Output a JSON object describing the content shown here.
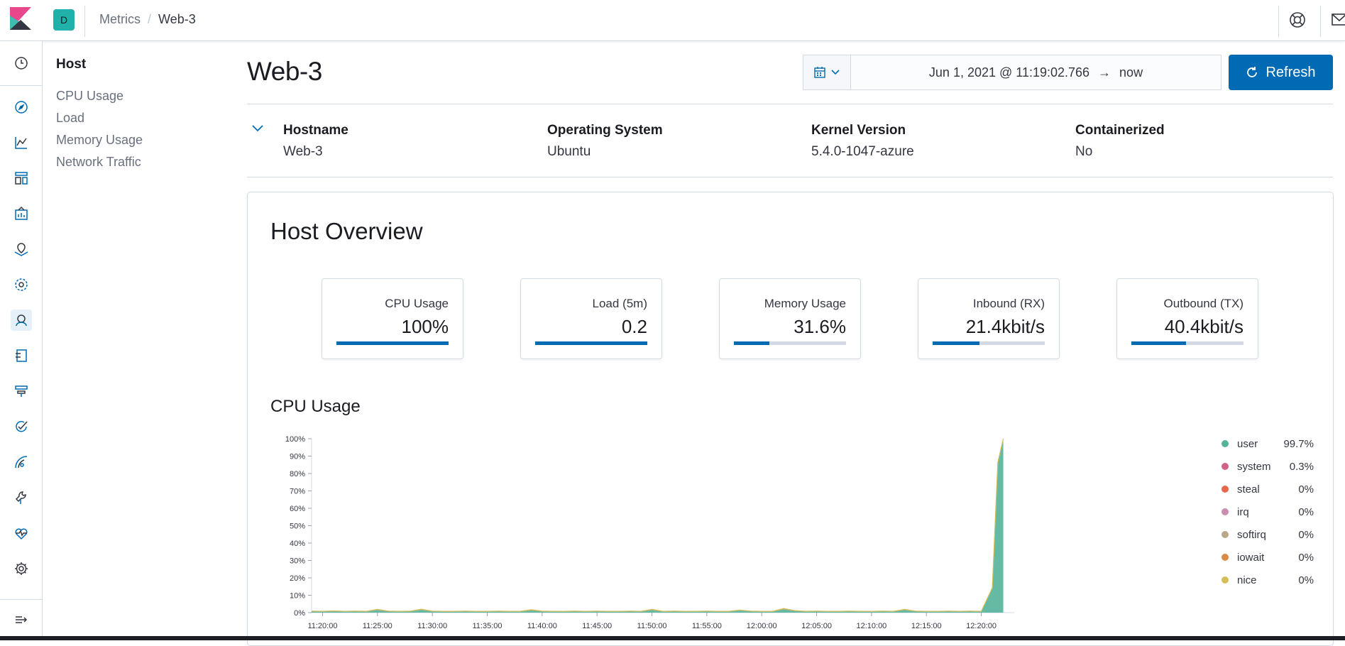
{
  "header": {
    "space_initial": "D",
    "breadcrumb_parent": "Metrics",
    "breadcrumb_sep": "/",
    "breadcrumb_current": "Web-3"
  },
  "sidenav": {
    "title": "Host",
    "items": [
      "CPU Usage",
      "Load",
      "Memory Usage",
      "Network Traffic"
    ]
  },
  "page": {
    "title": "Web-3"
  },
  "datepicker": {
    "start": "Jun 1, 2021 @ 11:19:02.766",
    "arrow": "→",
    "end": "now"
  },
  "refresh_label": "Refresh",
  "host_info": [
    {
      "label": "Hostname",
      "value": "Web-3"
    },
    {
      "label": "Operating System",
      "value": "Ubuntu"
    },
    {
      "label": "Kernel Version",
      "value": "5.4.0-1047-azure"
    },
    {
      "label": "Containerized",
      "value": "No"
    }
  ],
  "overview": {
    "title": "Host Overview",
    "kpis": [
      {
        "label": "CPU Usage",
        "value": "100%",
        "fraction": 1.0
      },
      {
        "label": "Load (5m)",
        "value": "0.2",
        "fraction": 1.0
      },
      {
        "label": "Memory Usage",
        "value": "31.6%",
        "fraction": 0.316
      },
      {
        "label": "Inbound (RX)",
        "value": "21.4kbit/s",
        "fraction": 0.42
      },
      {
        "label": "Outbound (TX)",
        "value": "40.4kbit/s",
        "fraction": 0.49
      }
    ]
  },
  "colors": {
    "accent": "#006bb4",
    "user": "#54b399",
    "system": "#d36086",
    "steal": "#e7664c",
    "irq": "#ca8eae",
    "softirq": "#b9a888",
    "iowait": "#da8b45",
    "nice": "#d6bf57"
  },
  "chart_data": {
    "type": "area",
    "title": "CPU Usage",
    "y_ticks": [
      "0%",
      "10%",
      "20%",
      "30%",
      "40%",
      "50%",
      "60%",
      "70%",
      "80%",
      "90%",
      "100%"
    ],
    "x_ticks": [
      "11:20:00",
      "11:25:00",
      "11:30:00",
      "11:35:00",
      "11:40:00",
      "11:45:00",
      "11:50:00",
      "11:55:00",
      "12:00:00",
      "12:05:00",
      "12:10:00",
      "12:15:00",
      "12:20:00"
    ],
    "ylim": [
      0,
      100
    ],
    "x_minutes": [
      0,
      1,
      2,
      3,
      4,
      5,
      6,
      7,
      8,
      9,
      10,
      11,
      12,
      13,
      14,
      15,
      16,
      17,
      18,
      19,
      20,
      21,
      22,
      23,
      24,
      25,
      26,
      27,
      28,
      29,
      30,
      31,
      32,
      33,
      34,
      35,
      36,
      37,
      38,
      39,
      40,
      41,
      42,
      43,
      44,
      45,
      46,
      47,
      48,
      49,
      50,
      51,
      52,
      53,
      54,
      55,
      56,
      57,
      58,
      59,
      60,
      61,
      62,
      62.5,
      63
    ],
    "series": [
      {
        "name": "user",
        "values": [
          0.6,
          0.5,
          0.7,
          0.5,
          0.6,
          0.5,
          1.5,
          0.6,
          0.5,
          0.6,
          1.6,
          0.6,
          0.5,
          0.5,
          0.6,
          0.5,
          0.5,
          0.6,
          0.5,
          0.5,
          1.3,
          0.6,
          0.5,
          0.5,
          0.6,
          0.5,
          0.6,
          0.5,
          0.5,
          0.6,
          0.5,
          1.5,
          0.5,
          0.6,
          0.5,
          0.5,
          0.6,
          0.5,
          0.5,
          1.2,
          0.6,
          0.5,
          0.5,
          1.9,
          0.9,
          0.5,
          0.6,
          0.5,
          0.5,
          0.6,
          0.5,
          0.5,
          0.6,
          0.5,
          1.5,
          0.6,
          0.5,
          0.5,
          0.6,
          0.5,
          0.6,
          0.5,
          14,
          86,
          99.7
        ]
      },
      {
        "name": "system",
        "values": [
          0.3,
          0.3,
          0.3,
          0.3,
          0.3,
          0.3,
          0.4,
          0.3,
          0.3,
          0.3,
          0.4,
          0.3,
          0.3,
          0.3,
          0.3,
          0.3,
          0.3,
          0.3,
          0.3,
          0.3,
          0.4,
          0.3,
          0.3,
          0.3,
          0.3,
          0.3,
          0.3,
          0.3,
          0.3,
          0.3,
          0.3,
          0.4,
          0.3,
          0.3,
          0.3,
          0.3,
          0.3,
          0.3,
          0.3,
          0.3,
          0.3,
          0.3,
          0.3,
          0.5,
          0.3,
          0.3,
          0.3,
          0.3,
          0.3,
          0.3,
          0.3,
          0.3,
          0.3,
          0.3,
          0.4,
          0.3,
          0.3,
          0.3,
          0.3,
          0.3,
          0.3,
          0.3,
          0.3,
          0.3,
          0.3
        ]
      }
    ],
    "legend": [
      {
        "name": "user",
        "value": "99.7%"
      },
      {
        "name": "system",
        "value": "0.3%"
      },
      {
        "name": "steal",
        "value": "0%"
      },
      {
        "name": "irq",
        "value": "0%"
      },
      {
        "name": "softirq",
        "value": "0%"
      },
      {
        "name": "iowait",
        "value": "0%"
      },
      {
        "name": "nice",
        "value": "0%"
      }
    ]
  }
}
